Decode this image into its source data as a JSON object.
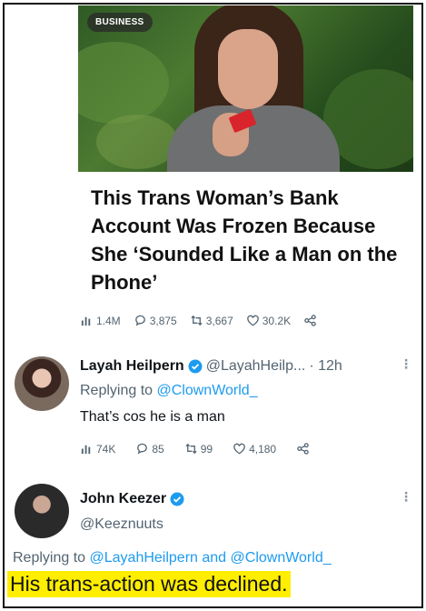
{
  "article": {
    "badge": "BUSINESS",
    "headline": "This Trans Woman’s Bank Account Was Frozen Because She ‘Sounded Like a Man on the Phone’",
    "stats": {
      "views": "1.4M",
      "replies": "3,875",
      "retweets": "3,667",
      "likes": "30.2K"
    }
  },
  "reply1": {
    "name": "Layah Heilpern",
    "handle": "@LayahHeilp...",
    "time": "· 12h",
    "replying_prefix": "Replying to ",
    "replying_to": "@ClownWorld_",
    "text": "That’s cos he is a man",
    "stats": {
      "views": "74K",
      "replies": "85",
      "retweets": "99",
      "likes": "4,180"
    }
  },
  "reply2": {
    "name": "John Keezer",
    "handle": "@Keeznuuts",
    "replying_prefix": "Replying to ",
    "replying_to_1": "@LayahHeilpern",
    "replying_and": " and ",
    "replying_to_2": "@ClownWorld_",
    "text": "His trans-action was declined."
  },
  "colors": {
    "link": "#1d9bf0",
    "muted": "#536471",
    "highlight": "#ffee00",
    "verified": "#1d9bf0"
  }
}
